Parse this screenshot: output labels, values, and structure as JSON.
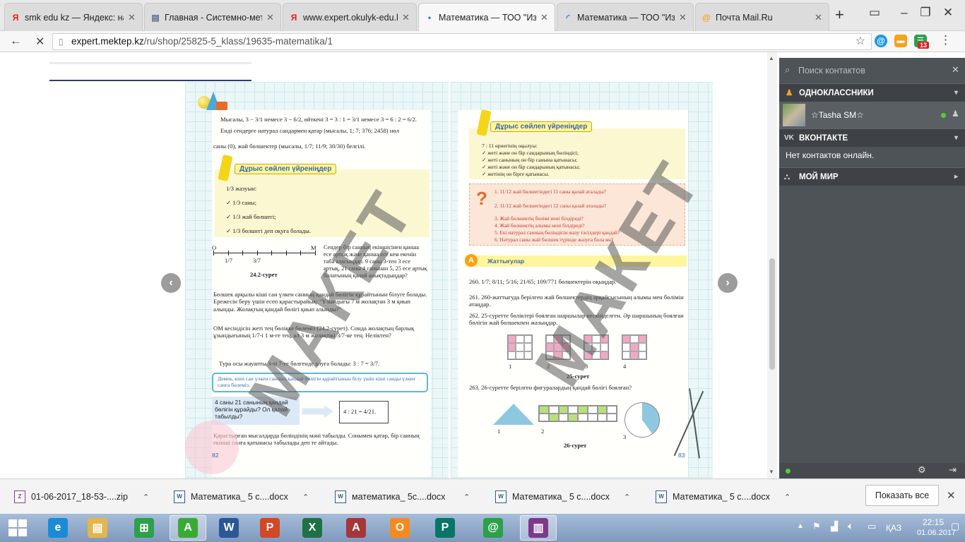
{
  "browser": {
    "tabs": [
      {
        "favicon": "yandex-icon",
        "favicon_char": "Я",
        "color": "#e21e1e",
        "title": "smk edu kz — Яндекс: нашл",
        "active": false
      },
      {
        "favicon": "document-icon",
        "favicon_char": "▤",
        "color": "#5a6e8a",
        "title": "Главная - Системно-методи",
        "active": false
      },
      {
        "favicon": "yandex-icon",
        "favicon_char": "Я",
        "color": "#e21e1e",
        "title": "www.expert.okulyk-edu.kz —",
        "active": false
      },
      {
        "favicon": "loading-icon",
        "favicon_char": "•",
        "color": "#2a7ad8",
        "title": "Математика — ТОО \"Издате",
        "active": true
      },
      {
        "favicon": "loading-icon",
        "favicon_char": "◜",
        "color": "#2a7ad8",
        "title": "Математика — ТОО \"Издате",
        "active": false
      },
      {
        "favicon": "mail-icon",
        "favicon_char": "@",
        "color": "#f6a21a",
        "title": "Почта Mail.Ru",
        "active": false
      }
    ],
    "url_host": "expert.mektep.kz",
    "url_path": "/ru/shop/25825-5_klass/19635-matematika/1",
    "badge_count": "13"
  },
  "book": {
    "left": {
      "line1": "Мысалы, 3 − 3/1 немесе 3 − 6/2, өйткені 3 = 3 : 1 = 3/1 немесе 3 = 6 : 2 = 6/2.",
      "line2": "Енді сендерге натурал сандармен қатар (мысалы, 1; 7; 376; 2458) нөл",
      "line3": "саны (0), жай бөлшектер (мысалы, 1/7; 11/9; 30/30) белгілі.",
      "learn_header": "Дұрыс сөйлеп үйреніңдер",
      "learn_items": [
        "1/3 жазуын:",
        "✓ 1/3 саны;",
        "✓ 1/3 жай бөлшегі;",
        "✓ 1/3 бөлшегі деп оқуға болады."
      ],
      "fig_caption": "24.2-сурет",
      "fig_o": "O",
      "fig_m": "M",
      "fig_tick1": "1/7",
      "fig_tick2": "3/7",
      "side_text": "Сендер бір санның екіншісінен қанша есе артық және қанша есе кем екенін таба аласыңдар. 9 саны 3-тен 3 есе артық, 21 саны 4 санынан 5, 25 есе артық болатының қалай анықтадыңдар?",
      "para1": "Бөлшек арқылы кіші сан үлкен санның қандай бөлігін құрайтынын білуге болады. Ережесін беру үшін есеп қарастырайық: \"Ұзындығы 7 м жолақтан 3 м қиып алынды. Жолақтың қандай бөлігі қиып алынды?\"",
      "para2": "OM кесіндісін жеті тең бөлікке бөлеміз (24.2-сурет). Сонда жолақтың барлық ұзындығының 1/7-і 1 м-ге тең, ал 3 м жолақтікі 3/7-ке тең. Неліктен?",
      "para3": "Тура осы жауапты 3-ті 7-ге бөлгенде алуға болады: 3 : 7 = 3/7.",
      "rule": "Демек, кіші сан үлкен санның қандай бөлігін құрайтынын білу үшін кіші санды үлкен санға бөлеміз.",
      "question": "4 саны 21 санының қандай бөлігін құрайды? Ол қалай табылды?",
      "answer": "4 : 21 = 4/21.",
      "para4": "Қарастырған мысалдарда бөліндінің мәні табылды. Сонымен қатар, бір санның екінші санға қатынасы табылады деп те айтады.",
      "page_number": "82"
    },
    "right": {
      "learn_header": "Дұрыс сөйлеп үйреніңдер",
      "learn_items": [
        "7 : 11 өрнегінің оқылуы:",
        "✓ жеті және он бір сандарының бөліндісі;",
        "✓ жеті санының он бір санына қатынасы;",
        "✓ жеті және он бір сандарының қатынасы;",
        "✓ жетінің он бірге қатынасы."
      ],
      "questions": [
        "1. 11/12 жай бөлшегіндегі 11 саны қалай аталады?",
        "2. 11/12 жай бөлшегіндегі 12 саны қалай аталады?",
        "3. Жай бөлшектің бөлімі нені білдіреді?",
        "4. Жай бөлшектің алымы нені білдіреді?",
        "5. Екі натурал санның бөліндісін жазу тәсілдері қандай?",
        "6. Натурал саны жай бөлшек түрінде жазуға бола ма?"
      ],
      "exercises_header": "Жаттығулар",
      "ex260": "260. 1/7; 8/11; 5/16; 21/65; 109/771 бөлшектерін оқыңдар.",
      "ex261": "261. 260-жаттығуда берілген жай бөлшектердің әрқайсысының алымы мен бөлімін атаңдар.",
      "ex262": "262. 25-суретте бөліктері боялған шаршылар кескінделген. Әр шаршының боялған бөлігін жай бөлшекпен жазыңдар.",
      "fig25_labels": [
        "1",
        "2",
        "3",
        "4"
      ],
      "fig25_caption": "25-сурет",
      "ex263": "263. 26-суретте берілген фигуралардың қандай бөлігі боялған?",
      "fig26_labels": [
        "1",
        "2",
        "3"
      ],
      "fig26_caption": "26-сурет",
      "page_number": "83"
    },
    "watermark": "МАКЕТ"
  },
  "sidebar": {
    "search_placeholder": "Поиск контактов",
    "sections": [
      {
        "title": "ОДНОКЛАССНИКИ",
        "arrow": "▾"
      },
      {
        "title": "ВКОНТАКТЕ",
        "arrow": "▾"
      },
      {
        "title": "МОЙ МИР",
        "arrow": "▸"
      }
    ],
    "contact_name": "☆Tasha SM☆",
    "no_contacts": "Нет контактов онлайн."
  },
  "downloads": {
    "items": [
      "01-06-2017_18-53-....zip",
      "Математика_ 5 с....docx",
      "математика_ 5с....docx",
      "Математика_ 5 с....docx",
      "Математика_ 5 с....docx"
    ],
    "show_all": "Показать все"
  },
  "taskbar": {
    "apps": [
      {
        "icon": "ie-icon",
        "char": "e",
        "color": "#1c8bd6"
      },
      {
        "icon": "explorer-icon",
        "char": "▤",
        "color": "#e3b64b"
      },
      {
        "icon": "store-icon",
        "char": "⊞",
        "color": "#2ba14a"
      },
      {
        "icon": "yandex-browser-icon",
        "char": "A",
        "color": "#3aaa35"
      },
      {
        "icon": "word-icon",
        "char": "W",
        "color": "#2b5797"
      },
      {
        "icon": "powerpoint-icon",
        "char": "P",
        "color": "#d24726"
      },
      {
        "icon": "excel-icon",
        "char": "X",
        "color": "#1e7145"
      },
      {
        "icon": "access-icon",
        "char": "A",
        "color": "#a4373a"
      },
      {
        "icon": "outlook-icon",
        "char": "O",
        "color": "#f58a1f"
      },
      {
        "icon": "publisher-icon",
        "char": "P",
        "color": "#077568"
      },
      {
        "icon": "mailru-agent-icon",
        "char": "@",
        "color": "#2ba14a"
      },
      {
        "icon": "winrar-icon",
        "char": "▥",
        "color": "#7a3b8a"
      }
    ],
    "lang": "ҚАЗ",
    "time": "22:15",
    "date": "01.06.2017"
  }
}
